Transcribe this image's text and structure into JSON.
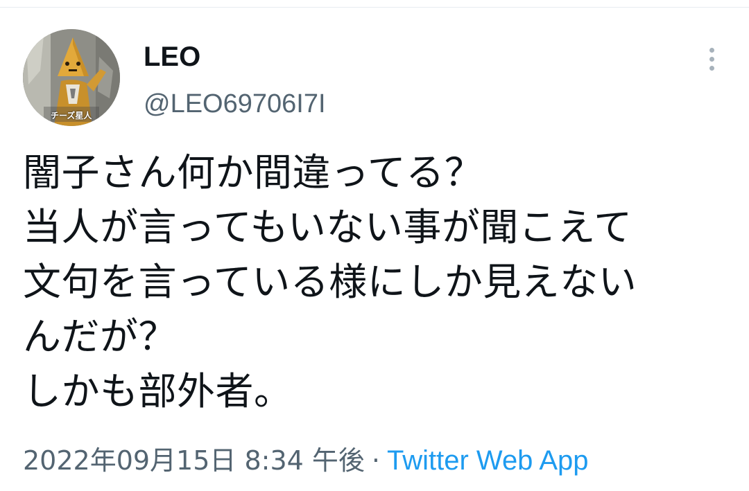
{
  "tweet": {
    "display_name": "LEO",
    "handle": "@LEO69706I7I",
    "avatar_caption": "チーズ星人",
    "text_lines": [
      "闇子さん何か間違ってる？",
      "当人が言ってもいない事が聞こえて",
      "文句を言っている様にしか見えない",
      "んだが？",
      "しかも部外者。"
    ],
    "timestamp": "2022年09月15日 8:34 午後",
    "separator": "·",
    "source": "Twitter Web App"
  },
  "icons": {
    "more": "more-vertical-icon"
  },
  "colors": {
    "text": "#0f1419",
    "secondary": "#536471",
    "link": "#1d9bf0",
    "more_dots": "#a7b2bb"
  }
}
